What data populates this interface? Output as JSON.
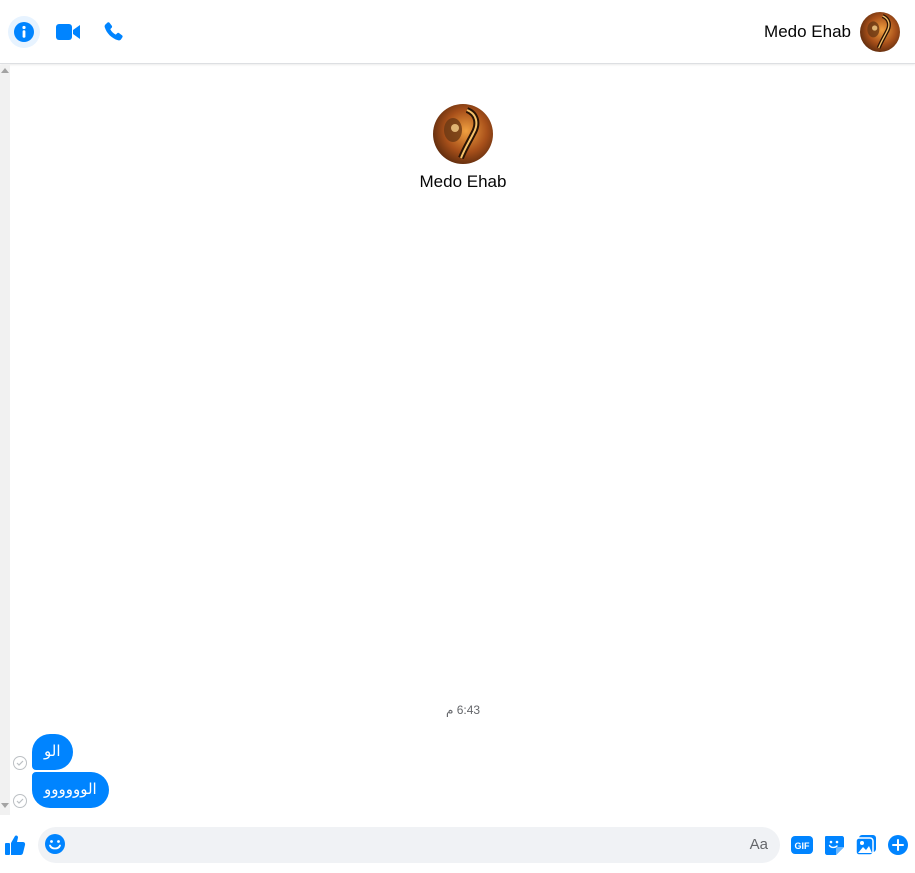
{
  "header": {
    "contact_name": "Medo Ehab",
    "buttons": [
      {
        "name": "info",
        "icon": "info-icon"
      },
      {
        "name": "video-call",
        "icon": "video-camera-icon"
      },
      {
        "name": "voice-call",
        "icon": "phone-icon"
      }
    ]
  },
  "profile": {
    "name": "Medo Ehab"
  },
  "conversation": {
    "timestamp": "6:43 م",
    "messages": [
      {
        "text": "الو",
        "status": "sent-check-icon"
      },
      {
        "text": "الوووووو",
        "status": "sent-check-icon"
      }
    ]
  },
  "composer": {
    "placeholder": "Aa",
    "actions": [
      "like-thumb-icon",
      "emoji-icon",
      "gif-icon",
      "sticker-icon",
      "photo-icon",
      "add-icon"
    ],
    "gif_label": "GIF"
  },
  "colors": {
    "accent": "#0084ff",
    "bubble_text": "#ffffff",
    "composer_bg": "#f0f2f5"
  }
}
